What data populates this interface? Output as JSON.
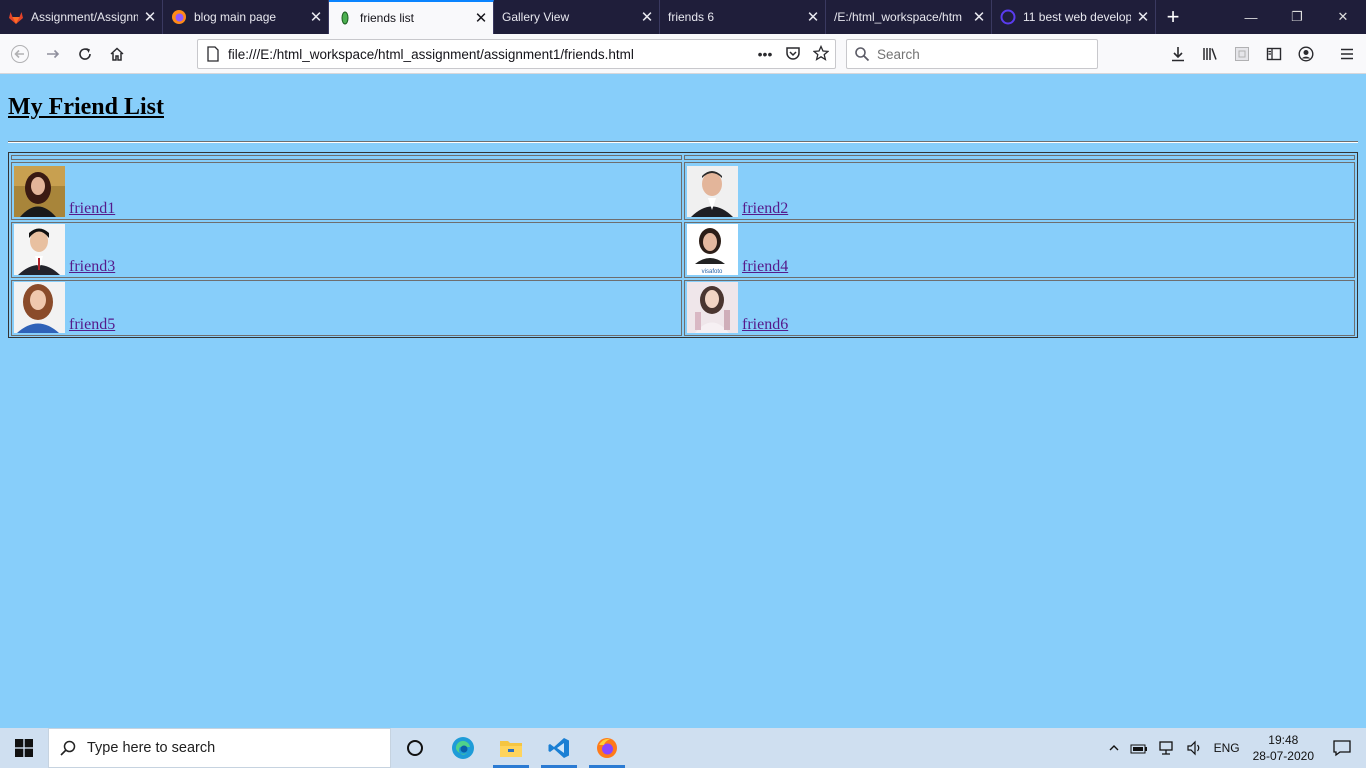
{
  "browser": {
    "tabs": [
      {
        "label": "Assignment/Assignm",
        "icon": "gitlab-icon",
        "active": false
      },
      {
        "label": "blog main page",
        "icon": "firefox-icon",
        "active": false
      },
      {
        "label": "friends list",
        "icon": "page-icon",
        "active": true
      },
      {
        "label": "Gallery View",
        "icon": "",
        "active": false
      },
      {
        "label": "friends 6",
        "icon": "",
        "active": false
      },
      {
        "label": "/E:/html_workspace/htm",
        "icon": "",
        "active": false
      },
      {
        "label": "11 best web develop",
        "icon": "site-icon",
        "active": false
      }
    ],
    "url": "file:///E:/html_workspace/html_assignment/assignment1/friends.html",
    "search_placeholder": "Search"
  },
  "page": {
    "title": "My Friend List",
    "friends": [
      {
        "name": "friend1",
        "photo": "woman-dark-hair"
      },
      {
        "name": "friend2",
        "photo": "man-suit"
      },
      {
        "name": "friend3",
        "photo": "man-tie"
      },
      {
        "name": "friend4",
        "photo": "woman-visafoto",
        "caption": "visafoto"
      },
      {
        "name": "friend5",
        "photo": "woman-blue-top"
      },
      {
        "name": "friend6",
        "photo": "girl-light"
      }
    ]
  },
  "taskbar": {
    "search_placeholder": "Type here to search",
    "lang": "ENG",
    "time": "19:48",
    "date": "28-07-2020"
  }
}
